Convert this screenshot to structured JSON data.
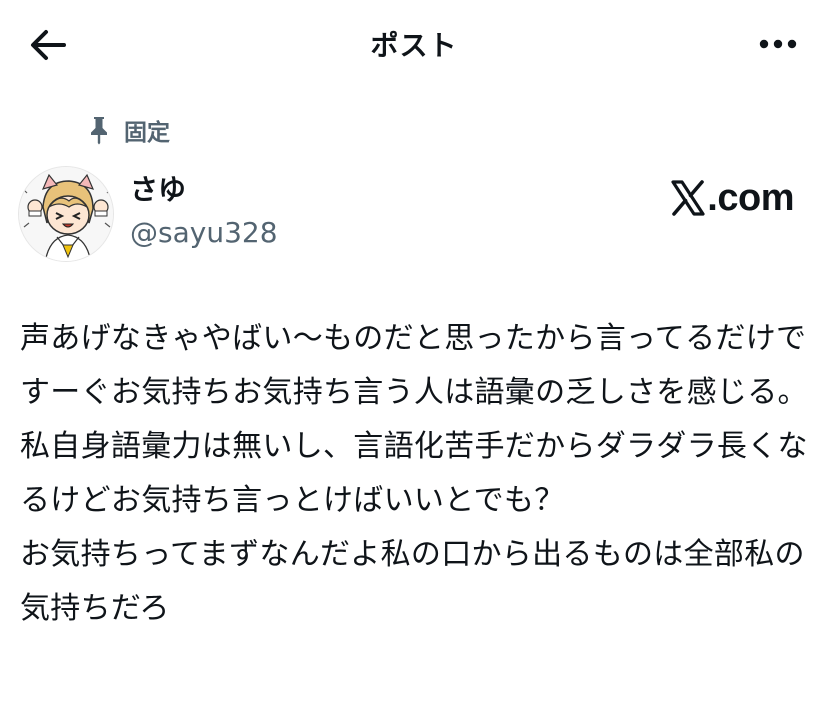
{
  "header": {
    "title": "ポスト",
    "back_icon": "arrow-left-icon",
    "more_icon": "more-horizontal-icon"
  },
  "pinned": {
    "label": "固定",
    "icon": "pin-icon"
  },
  "author": {
    "display_name": "さゆ",
    "handle": "@sayu328",
    "avatar": "anime-girl-avatar"
  },
  "watermark": {
    "brand": "X",
    "suffix": ".com"
  },
  "post": {
    "text": "声あげなきゃやばい〜ものだと思ったから言ってるだけですーぐお気持ちお気持ち言う人は語彙の乏しさを感じる。私自身語彙力は無いし、言語化苦手だからダラダラ長くなるけどお気持ち言っとけばいいとでも？\nお気持ちってまずなんだよ私の口から出るものは全部私の気持ちだろ"
  },
  "colors": {
    "text_primary": "#0f1419",
    "text_secondary": "#536471",
    "background": "#ffffff"
  }
}
